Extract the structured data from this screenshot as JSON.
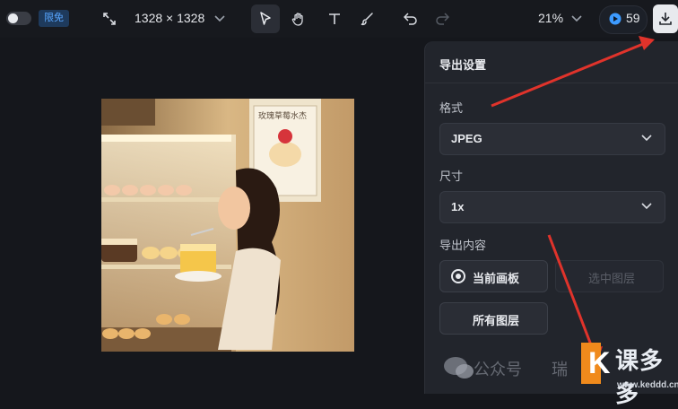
{
  "toolbar": {
    "color_tag": "限免",
    "canvas_size": "1328 × 1328",
    "zoom": "21%",
    "credits": "59"
  },
  "panel": {
    "title": "导出设置",
    "format_label": "格式",
    "format_value": "JPEG",
    "size_label": "尺寸",
    "size_value": "1x",
    "content_label": "导出内容",
    "options": {
      "current_artboard": "当前画板",
      "selected_layers": "选中图层",
      "all_layers": "所有图层"
    }
  },
  "canvas": {
    "poster_text": "玫瑰草莓水杰"
  },
  "watermark": {
    "wechat_text": "公众号",
    "brand_text": "瑞",
    "logo_text": "课多多",
    "url": "www.keddd.cn"
  },
  "colors": {
    "accent": "#58a6ff",
    "arrow": "#e0332b",
    "panel_bg": "#22252c"
  }
}
